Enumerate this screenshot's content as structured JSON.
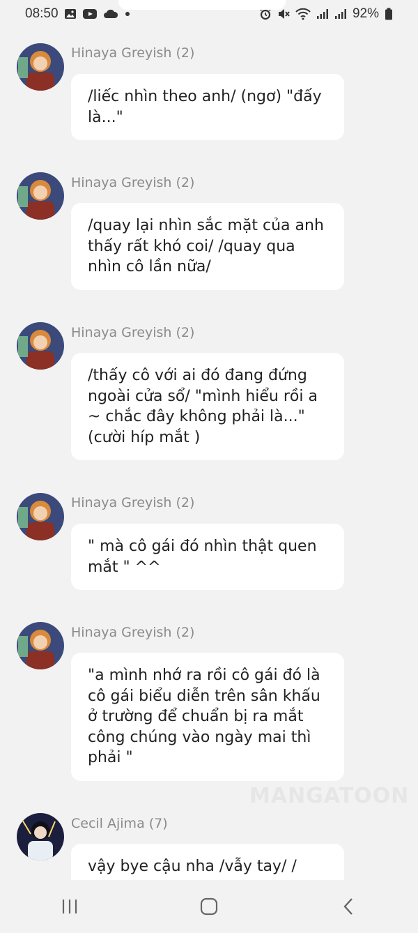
{
  "status_bar": {
    "time": "08:50",
    "left_icons": [
      "gallery-icon",
      "youtube-icon",
      "cloud-icon",
      "dot-icon"
    ],
    "right_icons": [
      "alarm-icon",
      "mute-icon",
      "wifi-icon",
      "signal-icon",
      "signal-icon",
      "battery-icon"
    ],
    "battery": "92%"
  },
  "messages": [
    {
      "author": "Hinaya Greyish (2)",
      "avatar": "hinaya-avatar",
      "text": "/liếc nhìn theo anh/ (ngơ) \"đấy là...\""
    },
    {
      "author": "Hinaya Greyish (2)",
      "avatar": "hinaya-avatar",
      "text": "/quay lại nhìn sắc mặt của anh thấy rất khó coi/ /quay qua nhìn cô lần nữa/"
    },
    {
      "author": "Hinaya Greyish (2)",
      "avatar": "hinaya-avatar",
      "text": "/thấy cô với ai đó đang đứng ngoài cửa sổ/ \"mình hiểu rồi a ~ chắc đây không phải là...\" (cười híp mắt )"
    },
    {
      "author": "Hinaya Greyish (2)",
      "avatar": "hinaya-avatar",
      "text": "\" mà cô gái đó nhìn thật quen mắt \" ^^"
    },
    {
      "author": "Hinaya Greyish (2)",
      "avatar": "hinaya-avatar",
      "text": "\"a mình nhớ ra rồi cô gái đó là cô gái biểu diễn trên sân khấu ở trường để chuẩn bị ra mắt công chúng vào ngày mai thì phải \""
    },
    {
      "author": "Cecil Ajima (7)",
      "avatar": "cecil-avatar",
      "text": "vậy bye cậu nha /vẫy tay/ /"
    }
  ],
  "watermark": "MANGATOON",
  "nav_bar": {
    "buttons": [
      "recent-apps",
      "home",
      "back"
    ]
  }
}
